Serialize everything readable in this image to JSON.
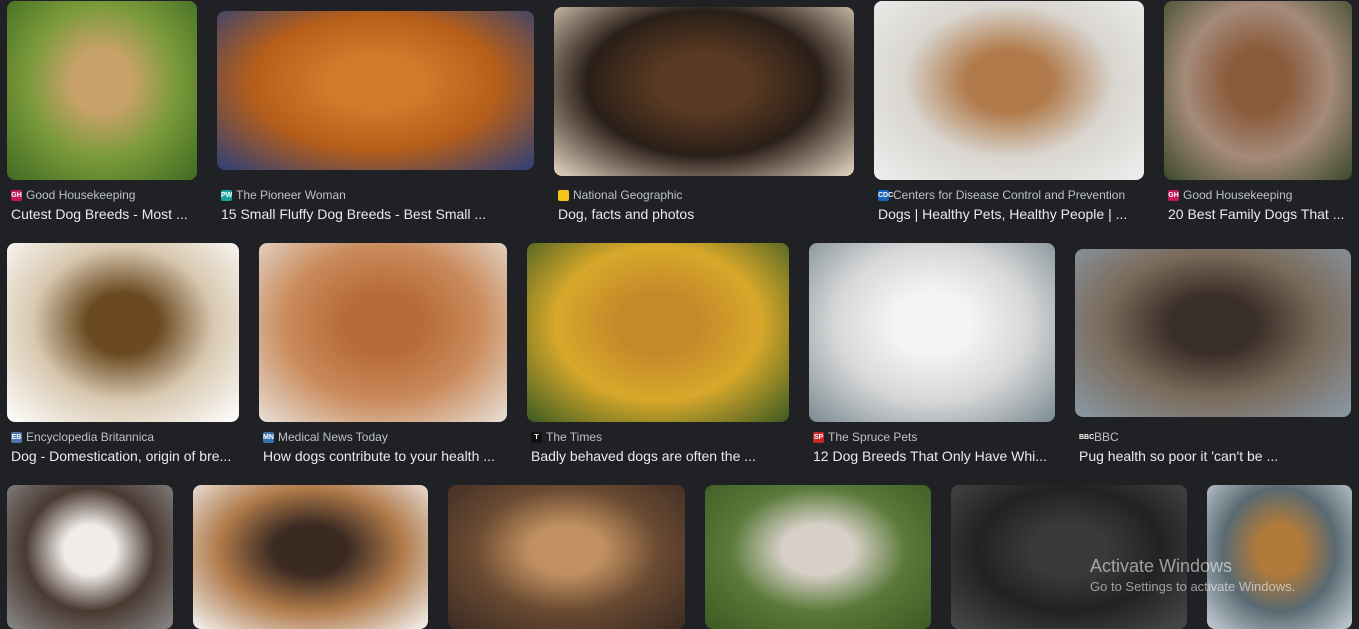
{
  "results": [
    {
      "source": "Good Housekeeping",
      "title": "Cutest Dog Breeds - Most ...",
      "fav": "GH",
      "favc": "#c2185b",
      "c1": "#c9a26a",
      "c2": "#7a9a3a",
      "c3": "#3f6a22"
    },
    {
      "source": "The Pioneer Woman",
      "title": "15 Small Fluffy Dog Breeds - Best Small ...",
      "fav": "PW",
      "favc": "#1aa39a",
      "c1": "#d07a2a",
      "c2": "#b55e1a",
      "c3": "#2b3f7a"
    },
    {
      "source": "National Geographic",
      "title": "Dog, facts and photos",
      "fav": "",
      "favc": "#f5c518",
      "c1": "#5a3a22",
      "c2": "#2a1f18",
      "c3": "#e8d7c4"
    },
    {
      "source": "Centers for Disease Control and Prevention",
      "title": "Dogs | Healthy Pets, Healthy People | ...",
      "fav": "CDC",
      "favc": "#1565c0",
      "c1": "#b07a4a",
      "c2": "#d9d6d0",
      "c3": "#eeeeee"
    },
    {
      "source": "Good Housekeeping",
      "title": "20 Best Family Dogs That ...",
      "fav": "GH",
      "favc": "#c2185b",
      "c1": "#8a5a3a",
      "c2": "#a58a7a",
      "c3": "#3a4a2a"
    },
    {
      "source": "Encyclopedia Britannica",
      "title": "Dog - Domestication, origin of bre...",
      "fav": "EB",
      "favc": "#4a76a8",
      "c1": "#6b4a22",
      "c2": "#d8c8b0",
      "c3": "#ffffff"
    },
    {
      "source": "Medical News Today",
      "title": "How dogs contribute to your health ...",
      "fav": "MN",
      "favc": "#3a6fb0",
      "c1": "#b86a3a",
      "c2": "#c98a5a",
      "c3": "#e8e0d8"
    },
    {
      "source": "The Times",
      "title": "Badly behaved dogs are often the ...",
      "fav": "T",
      "favc": "#111111",
      "c1": "#c48a2a",
      "c2": "#d8a82a",
      "c3": "#3a5a22"
    },
    {
      "source": "The Spruce Pets",
      "title": "12 Dog Breeds That Only Have Whi...",
      "fav": "SP",
      "favc": "#c62828",
      "c1": "#f4f4f4",
      "c2": "#d8d8d8",
      "c3": "#7a8a92"
    },
    {
      "source": "BBC",
      "title": "Pug health so poor it 'can't be ...",
      "fav": "BBC",
      "favc": "#222222",
      "c1": "#3a2e28",
      "c2": "#7a6a5a",
      "c3": "#8a9aa8"
    },
    {
      "source": "",
      "title": "",
      "fav": "",
      "favc": "#202124",
      "c1": "#f0ece8",
      "c2": "#4a3a32",
      "c3": "#8a8a8a"
    },
    {
      "source": "",
      "title": "",
      "fav": "",
      "favc": "#202124",
      "c1": "#3a2a22",
      "c2": "#b07a4a",
      "c3": "#f4f4f4"
    },
    {
      "source": "",
      "title": "",
      "fav": "",
      "favc": "#202124",
      "c1": "#c09060",
      "c2": "#6a4a32",
      "c3": "#3a2a22"
    },
    {
      "source": "",
      "title": "",
      "fav": "",
      "favc": "#202124",
      "c1": "#d8d0c8",
      "c2": "#5a7a3a",
      "c3": "#3a5a22"
    },
    {
      "source": "",
      "title": "",
      "fav": "",
      "favc": "#202124",
      "c1": "#3a3a3a",
      "c2": "#222222",
      "c3": "#4a4a4a"
    },
    {
      "source": "",
      "title": "",
      "fav": "",
      "favc": "#202124",
      "c1": "#b07a3a",
      "c2": "#5a6a72",
      "c3": "#c8d0d8"
    }
  ],
  "watermark": {
    "line1": "Activate Windows",
    "line2": "Go to Settings to activate Windows."
  }
}
